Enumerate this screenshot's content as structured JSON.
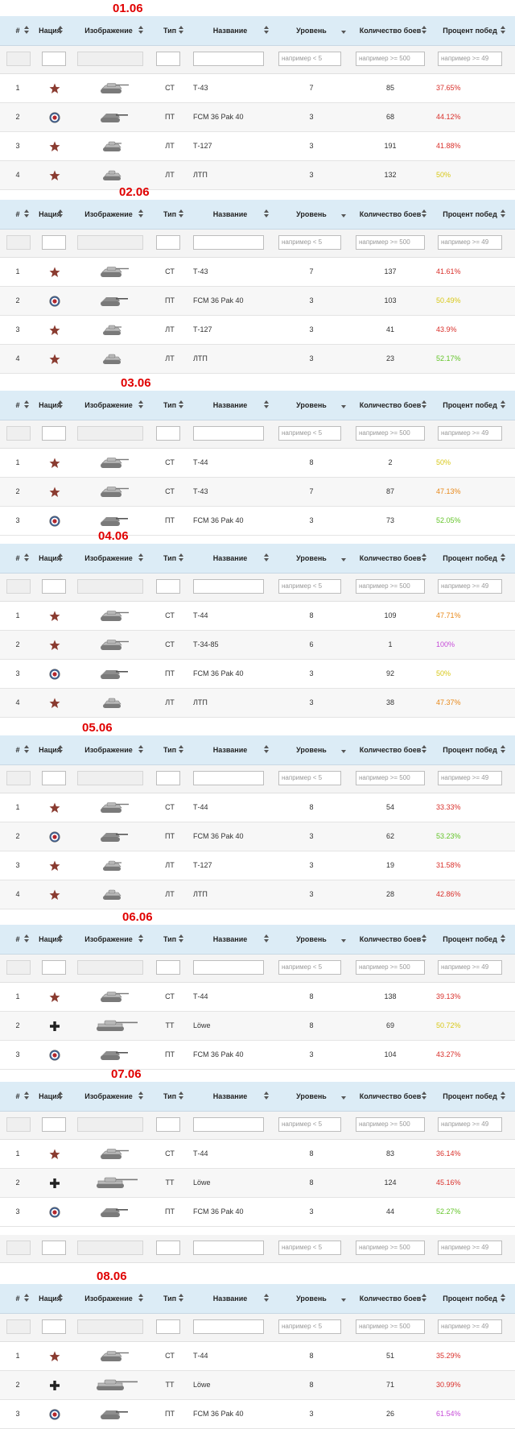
{
  "columns": {
    "num": "#",
    "nation": "Нация",
    "image": "Изображение",
    "type": "Тип",
    "name": "Название",
    "level": "Уровень",
    "battles": "Количество боев",
    "winrate": "Процент побед"
  },
  "filters": {
    "level_placeholder": "например < 5",
    "battles_placeholder": "например >= 500",
    "winrate_placeholder": "например >= 49"
  },
  "colors": {
    "header_bg": "#dcecf6",
    "date_red": "#e00000",
    "wr_red": "#d9302b",
    "wr_orange": "#e8891a",
    "wr_yellow": "#d8c818",
    "wr_green": "#63c428",
    "wr_purple": "#c64bd8"
  },
  "days": [
    {
      "date": "01.06",
      "rows": [
        {
          "num": "1",
          "nation": "ussr-star-icon",
          "tank": "medium",
          "type": "СТ",
          "name": "Т-43",
          "level": "7",
          "battles": "85",
          "winrate": "37.65%",
          "wr_color": "#d9302b"
        },
        {
          "num": "2",
          "nation": "france-roundel-icon",
          "tank": "td",
          "type": "ПТ",
          "name": "FCM 36 Pak 40",
          "level": "3",
          "battles": "68",
          "winrate": "44.12%",
          "wr_color": "#d9302b"
        },
        {
          "num": "3",
          "nation": "ussr-star-icon",
          "tank": "light",
          "type": "ЛТ",
          "name": "Т-127",
          "level": "3",
          "battles": "191",
          "winrate": "41.88%",
          "wr_color": "#d9302b"
        },
        {
          "num": "4",
          "nation": "ussr-star-icon",
          "tank": "light2",
          "type": "ЛТ",
          "name": "ЛТП",
          "level": "3",
          "battles": "132",
          "winrate": "50%",
          "wr_color": "#d8c818"
        }
      ]
    },
    {
      "date": "02.06",
      "rows": [
        {
          "num": "1",
          "nation": "ussr-star-icon",
          "tank": "medium",
          "type": "СТ",
          "name": "Т-43",
          "level": "7",
          "battles": "137",
          "winrate": "41.61%",
          "wr_color": "#d9302b"
        },
        {
          "num": "2",
          "nation": "france-roundel-icon",
          "tank": "td",
          "type": "ПТ",
          "name": "FCM 36 Pak 40",
          "level": "3",
          "battles": "103",
          "winrate": "50.49%",
          "wr_color": "#d8c818"
        },
        {
          "num": "3",
          "nation": "ussr-star-icon",
          "tank": "light",
          "type": "ЛТ",
          "name": "Т-127",
          "level": "3",
          "battles": "41",
          "winrate": "43.9%",
          "wr_color": "#d9302b"
        },
        {
          "num": "4",
          "nation": "ussr-star-icon",
          "tank": "light2",
          "type": "ЛТ",
          "name": "ЛТП",
          "level": "3",
          "battles": "23",
          "winrate": "52.17%",
          "wr_color": "#63c428"
        }
      ]
    },
    {
      "date": "03.06",
      "rows": [
        {
          "num": "1",
          "nation": "ussr-star-icon",
          "tank": "medium",
          "type": "СТ",
          "name": "Т-44",
          "level": "8",
          "battles": "2",
          "winrate": "50%",
          "wr_color": "#d8c818"
        },
        {
          "num": "2",
          "nation": "ussr-star-icon",
          "tank": "medium",
          "type": "СТ",
          "name": "Т-43",
          "level": "7",
          "battles": "87",
          "winrate": "47.13%",
          "wr_color": "#e8891a"
        },
        {
          "num": "3",
          "nation": "france-roundel-icon",
          "tank": "td",
          "type": "ПТ",
          "name": "FCM 36 Pak 40",
          "level": "3",
          "battles": "73",
          "winrate": "52.05%",
          "wr_color": "#63c428"
        }
      ]
    },
    {
      "date": "04.06",
      "rows": [
        {
          "num": "1",
          "nation": "ussr-star-icon",
          "tank": "medium",
          "type": "СТ",
          "name": "Т-44",
          "level": "8",
          "battles": "109",
          "winrate": "47.71%",
          "wr_color": "#e8891a"
        },
        {
          "num": "2",
          "nation": "ussr-star-icon",
          "tank": "medium",
          "type": "СТ",
          "name": "Т-34-85",
          "level": "6",
          "battles": "1",
          "winrate": "100%",
          "wr_color": "#c64bd8"
        },
        {
          "num": "3",
          "nation": "france-roundel-icon",
          "tank": "td",
          "type": "ПТ",
          "name": "FCM 36 Pak 40",
          "level": "3",
          "battles": "92",
          "winrate": "50%",
          "wr_color": "#d8c818"
        },
        {
          "num": "4",
          "nation": "ussr-star-icon",
          "tank": "light2",
          "type": "ЛТ",
          "name": "ЛТП",
          "level": "3",
          "battles": "38",
          "winrate": "47.37%",
          "wr_color": "#e8891a"
        }
      ]
    },
    {
      "date": "05.06",
      "rows": [
        {
          "num": "1",
          "nation": "ussr-star-icon",
          "tank": "medium",
          "type": "СТ",
          "name": "Т-44",
          "level": "8",
          "battles": "54",
          "winrate": "33.33%",
          "wr_color": "#d9302b"
        },
        {
          "num": "2",
          "nation": "france-roundel-icon",
          "tank": "td",
          "type": "ПТ",
          "name": "FCM 36 Pak 40",
          "level": "3",
          "battles": "62",
          "winrate": "53.23%",
          "wr_color": "#63c428"
        },
        {
          "num": "3",
          "nation": "ussr-star-icon",
          "tank": "light",
          "type": "ЛТ",
          "name": "Т-127",
          "level": "3",
          "battles": "19",
          "winrate": "31.58%",
          "wr_color": "#d9302b"
        },
        {
          "num": "4",
          "nation": "ussr-star-icon",
          "tank": "light2",
          "type": "ЛТ",
          "name": "ЛТП",
          "level": "3",
          "battles": "28",
          "winrate": "42.86%",
          "wr_color": "#d9302b"
        }
      ]
    },
    {
      "date": "06.06",
      "rows": [
        {
          "num": "1",
          "nation": "ussr-star-icon",
          "tank": "medium",
          "type": "СТ",
          "name": "Т-44",
          "level": "8",
          "battles": "138",
          "winrate": "39.13%",
          "wr_color": "#d9302b"
        },
        {
          "num": "2",
          "nation": "germany-cross-icon",
          "tank": "heavy",
          "type": "ТТ",
          "name": "Löwe",
          "level": "8",
          "battles": "69",
          "winrate": "50.72%",
          "wr_color": "#d8c818"
        },
        {
          "num": "3",
          "nation": "france-roundel-icon",
          "tank": "td",
          "type": "ПТ",
          "name": "FCM 36 Pak 40",
          "level": "3",
          "battles": "104",
          "winrate": "43.27%",
          "wr_color": "#d9302b"
        }
      ]
    },
    {
      "date": "07.06",
      "rows": [
        {
          "num": "1",
          "nation": "ussr-star-icon",
          "tank": "medium",
          "type": "СТ",
          "name": "Т-44",
          "level": "8",
          "battles": "83",
          "winrate": "36.14%",
          "wr_color": "#d9302b"
        },
        {
          "num": "2",
          "nation": "germany-cross-icon",
          "tank": "heavy",
          "type": "ТТ",
          "name": "Löwe",
          "level": "8",
          "battles": "124",
          "winrate": "45.16%",
          "wr_color": "#d9302b"
        },
        {
          "num": "3",
          "nation": "france-roundel-icon",
          "tank": "td",
          "type": "ПТ",
          "name": "FCM 36 Pak 40",
          "level": "3",
          "battles": "44",
          "winrate": "52.27%",
          "wr_color": "#63c428"
        }
      ]
    },
    {
      "date": "08.06",
      "rows": [
        {
          "num": "1",
          "nation": "ussr-star-icon",
          "tank": "medium",
          "type": "СТ",
          "name": "Т-44",
          "level": "8",
          "battles": "51",
          "winrate": "35.29%",
          "wr_color": "#d9302b"
        },
        {
          "num": "2",
          "nation": "germany-cross-icon",
          "tank": "heavy",
          "type": "ТТ",
          "name": "Löwe",
          "level": "8",
          "battles": "71",
          "winrate": "30.99%",
          "wr_color": "#d9302b"
        },
        {
          "num": "3",
          "nation": "france-roundel-icon",
          "tank": "td",
          "type": "ПТ",
          "name": "FCM 36 Pak 40",
          "level": "3",
          "battles": "26",
          "winrate": "61.54%",
          "wr_color": "#c64bd8"
        }
      ]
    }
  ]
}
